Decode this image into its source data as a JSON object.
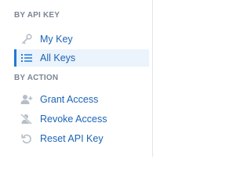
{
  "sections": [
    {
      "title": "BY API KEY",
      "items": [
        {
          "label": "My Key",
          "icon": "key-icon",
          "active": false
        },
        {
          "label": "All Keys",
          "icon": "list-icon",
          "active": true
        }
      ]
    },
    {
      "title": "BY ACTION",
      "items": [
        {
          "label": "Grant Access",
          "icon": "user-plus-icon",
          "active": false
        },
        {
          "label": "Revoke Access",
          "icon": "user-remove-icon",
          "active": false
        },
        {
          "label": "Reset API Key",
          "icon": "undo-icon",
          "active": false
        }
      ]
    }
  ],
  "colors": {
    "section_title": "#7a8594",
    "link": "#1b64b6",
    "active_bg": "#ebf3fc",
    "active_border": "#2179d6",
    "icon_muted": "#b7bec7"
  }
}
